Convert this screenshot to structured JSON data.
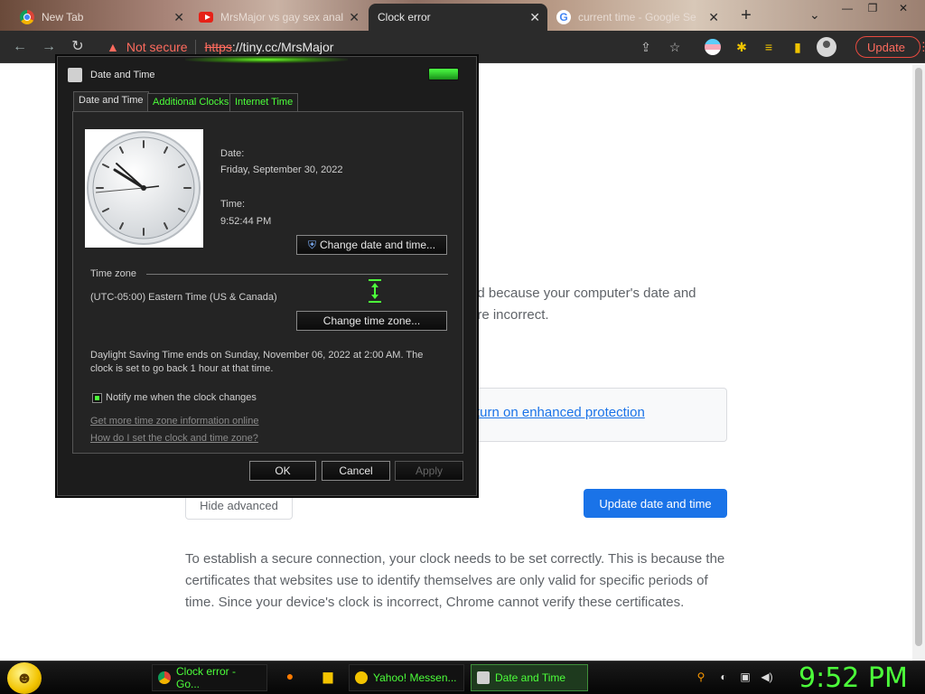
{
  "browser": {
    "tabs": [
      {
        "title": "New Tab",
        "icon": "chrome-icon"
      },
      {
        "title": "MrsMajor vs gay sex anal",
        "icon": "youtube-icon"
      },
      {
        "title": "Clock error",
        "icon": "none"
      },
      {
        "title": "current time - Google Se",
        "icon": "google-icon"
      }
    ],
    "new_tab_symbol": "+",
    "close_symbol": "✕",
    "tab_search_symbol": "⌄",
    "window_controls": {
      "minimize": "—",
      "maximize": "❐",
      "close": "✕"
    },
    "address": {
      "warning_icon": "▲",
      "not_secure": "Not secure",
      "scheme": "https",
      "rest": "://tiny.cc/MrsMajor"
    },
    "update_label": "Update",
    "update_menu": "⋮"
  },
  "page": {
    "body_line1": "ed because your computer's date and",
    "body_line2": "are incorrect.",
    "enhanced_link": "turn on enhanced protection",
    "hide_advanced": "Hide advanced",
    "update_date_time": "Update date and time",
    "explanation": "To establish a secure connection, your clock needs to be set correctly. This is because the certificates that websites use to identify themselves are only valid for specific periods of time. Since your device's clock is incorrect, Chrome cannot verify these certificates."
  },
  "dialog": {
    "title": "Date and Time",
    "tabs": [
      "Date and Time",
      "Additional Clocks",
      "Internet Time"
    ],
    "date_label": "Date:",
    "date_value": "Friday, September 30, 2022",
    "time_label": "Time:",
    "time_value": "9:52:44 PM",
    "change_date_time": "Change date and time...",
    "time_zone_header": "Time zone",
    "time_zone_value": "(UTC-05:00) Eastern Time (US & Canada)",
    "change_time_zone": "Change time zone...",
    "dst_line1": "Daylight Saving Time ends on Sunday, November 06, 2022 at 2:00 AM. The",
    "dst_line2": "clock is set to go back 1 hour at that time.",
    "notify_label": "Notify me when the clock changes",
    "notify_checked": true,
    "link_more_info": "Get more time zone information online",
    "link_how": "How do I set the clock and time zone?",
    "ok": "OK",
    "cancel": "Cancel",
    "apply": "Apply"
  },
  "taskbar": {
    "tasks": [
      {
        "label": "Clock error - Go...",
        "icon": "chrome-icon"
      },
      {
        "label": "Yahoo! Messen...",
        "icon": "yahoo-messenger-icon"
      },
      {
        "label": "Date and Time",
        "icon": "date-time-icon"
      }
    ],
    "clock": "9:52 PM"
  },
  "colors": {
    "accent_green": "#4cff3a",
    "chrome_blue": "#1a73e8",
    "warning_red": "#ff6b5e"
  }
}
